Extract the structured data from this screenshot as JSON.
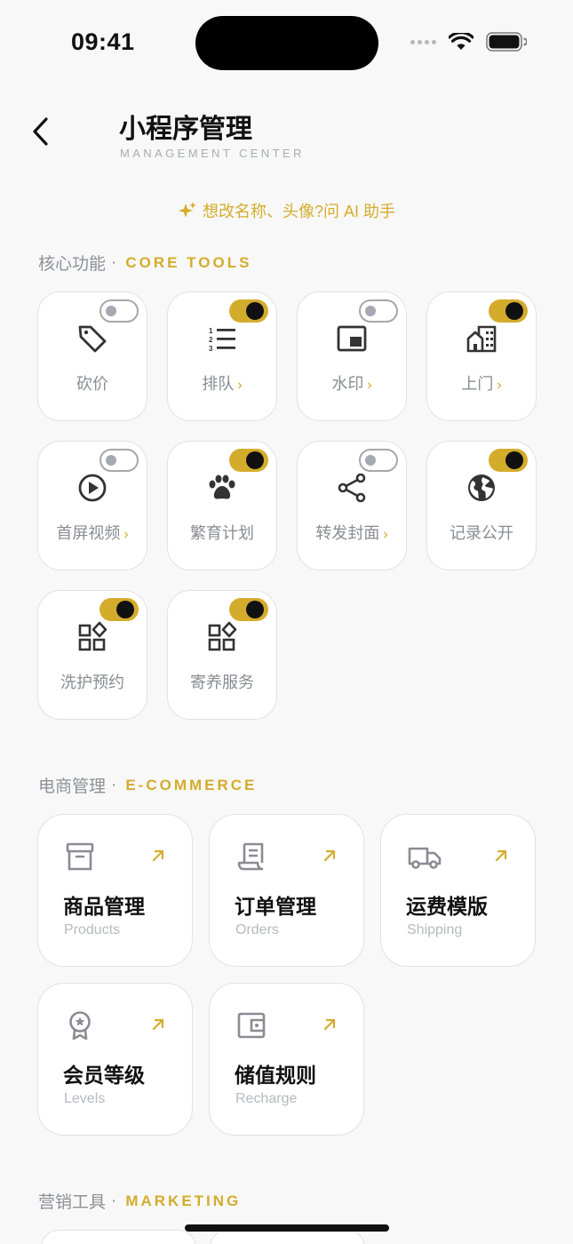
{
  "status": {
    "time": "09:41"
  },
  "header": {
    "title": "小程序管理",
    "subtitle": "MANAGEMENT CENTER"
  },
  "ai_hint": "想改名称、头像?问 AI 助手",
  "core": {
    "title_cn": "核心功能",
    "title_en": "CORE TOOLS",
    "tools": [
      {
        "label": "砍价",
        "icon": "tag-icon",
        "on": false,
        "chevron": false
      },
      {
        "label": "排队",
        "icon": "numbered-list-icon",
        "on": true,
        "chevron": true
      },
      {
        "label": "水印",
        "icon": "picture-in-picture-icon",
        "on": false,
        "chevron": true
      },
      {
        "label": "上门",
        "icon": "home-building-icon",
        "on": true,
        "chevron": true
      },
      {
        "label": "首屏视频",
        "icon": "play-circle-icon",
        "on": false,
        "chevron": true
      },
      {
        "label": "繁育计划",
        "icon": "paw-icon",
        "on": true,
        "chevron": false
      },
      {
        "label": "转发封面",
        "icon": "share-icon",
        "on": false,
        "chevron": true
      },
      {
        "label": "记录公开",
        "icon": "globe-icon",
        "on": true,
        "chevron": false
      },
      {
        "label": "洗护预约",
        "icon": "widgets-icon",
        "on": true,
        "chevron": false
      },
      {
        "label": "寄养服务",
        "icon": "widgets-icon",
        "on": true,
        "chevron": false
      }
    ]
  },
  "ecommerce": {
    "title_cn": "电商管理",
    "title_en": "E-COMMERCE",
    "cards": [
      {
        "name": "商品管理",
        "en": "Products",
        "icon": "archive-box-icon"
      },
      {
        "name": "订单管理",
        "en": "Orders",
        "icon": "receipt-icon"
      },
      {
        "name": "运费模版",
        "en": "Shipping",
        "icon": "truck-icon"
      },
      {
        "name": "会员等级",
        "en": "Levels",
        "icon": "award-badge-icon"
      },
      {
        "name": "储值规则",
        "en": "Recharge",
        "icon": "wallet-icon"
      }
    ]
  },
  "marketing": {
    "title_cn": "营销工具",
    "title_en": "MARKETING"
  },
  "colors": {
    "accent": "#d4ac2c",
    "background": "#f8f8f8",
    "card_border": "#e2e2e2"
  }
}
